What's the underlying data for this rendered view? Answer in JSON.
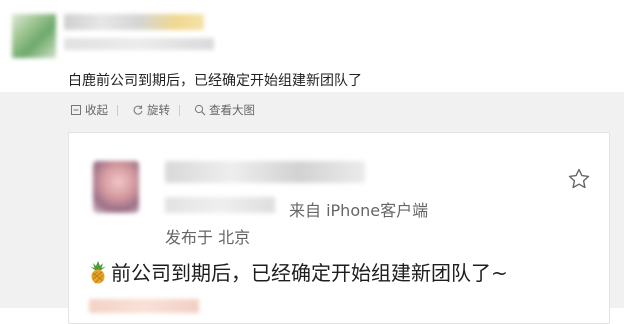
{
  "post": {
    "text": "白鹿前公司到期后，已经确定开始组建新团队了"
  },
  "actions": [
    {
      "label": "收起",
      "icon": "collapse-icon"
    },
    {
      "label": "旋转",
      "icon": "rotate-icon"
    },
    {
      "label": "查看大图",
      "icon": "zoom-in-icon"
    }
  ],
  "card": {
    "source": "来自 iPhone客户端",
    "location": "发布于 北京",
    "text": "前公司到期后，已经确定开始组建新团队了~",
    "emoji": "pineapple-icon"
  },
  "colors": {
    "band": "#f1f1f1",
    "meta_text": "#666666",
    "body_text": "#222222"
  }
}
